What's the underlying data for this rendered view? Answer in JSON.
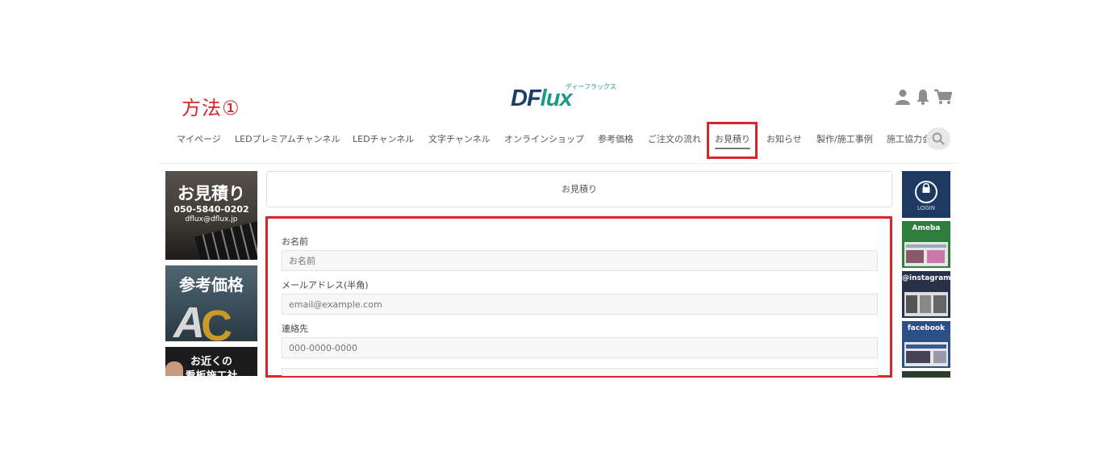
{
  "annotation": {
    "title": "方法①",
    "color": "#d9262b"
  },
  "brand": {
    "tagline": "ディーフラックス",
    "logo_part1": "DF",
    "logo_part2": "lux",
    "color_dark": "#1d3c6c",
    "color_teal": "#1a9b8a"
  },
  "header_icons": [
    "user-icon",
    "bell-icon",
    "cart-icon"
  ],
  "nav": {
    "items": [
      "マイページ",
      "LEDプレミアムチャンネル",
      "LEDチャンネル",
      "文字チャンネル",
      "オンラインショップ",
      "参考価格",
      "ご注文の流れ",
      "お見積り",
      "お知らせ",
      "製作/施工事例",
      "施工協力会"
    ],
    "active_index": 7,
    "search_icon": "search-icon"
  },
  "left_banners": {
    "estimate": {
      "title": "お見積り",
      "phone": "050-5840-0202",
      "email": "dflux@dflux.jp"
    },
    "price": {
      "title": "参考価格"
    },
    "nearby": {
      "line1": "お近くの",
      "line2": "看板施工社"
    }
  },
  "page": {
    "heading": "お見積り"
  },
  "form": {
    "name_label": "お名前",
    "name_placeholder": "お名前",
    "email_label": "メールアドレス(半角)",
    "email_placeholder": "email@example.com",
    "contact_label": "連絡先",
    "contact_placeholder": "000-0000-0000"
  },
  "right_sidebar": {
    "login_label": "LOGIN",
    "ameba_label": "Ameba",
    "instagram_label": "@instagram",
    "facebook_label": "facebook"
  }
}
